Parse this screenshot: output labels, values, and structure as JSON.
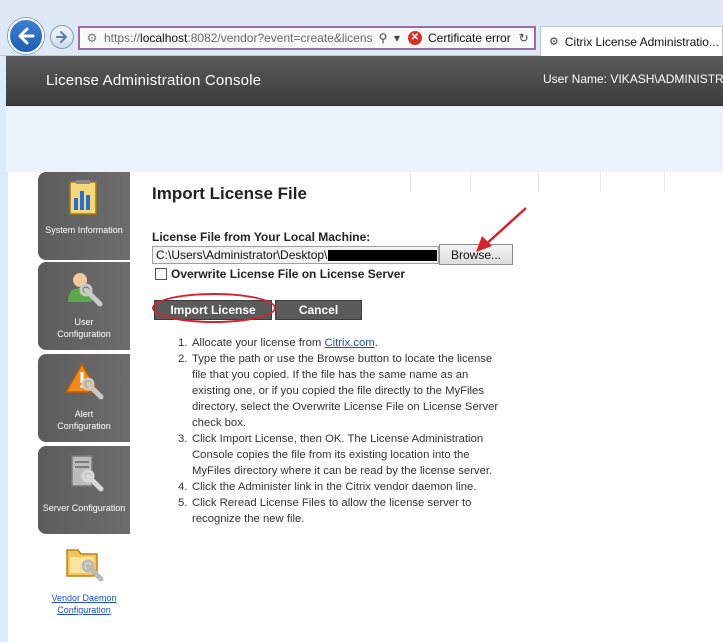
{
  "browser": {
    "url_prefix": "https://",
    "url_host": "localhost",
    "url_rest": ":8082/vendor?event=create&licens",
    "cert_error": "Certificate error",
    "tab_title": "Citrix License Administratio..."
  },
  "header": {
    "title": "License Administration Console",
    "user": "User Name: VIKASH\\ADMINISTRA"
  },
  "sidebar": {
    "items": [
      {
        "label_lines": [
          "System Information"
        ]
      },
      {
        "label_lines": [
          "User",
          "Configuration"
        ]
      },
      {
        "label_lines": [
          "Alert",
          "Configuration"
        ]
      },
      {
        "label_lines": [
          "Server Configuration"
        ]
      },
      {
        "label_lines": [
          "Vendor Daemon",
          "Configuration"
        ]
      }
    ]
  },
  "main": {
    "title": "Import License File",
    "file_label": "License File from Your Local Machine:",
    "file_path": "C:\\Users\\Administrator\\Desktop\\",
    "browse_label": "Browse...",
    "overwrite_label": "Overwrite License File on License Server",
    "overwrite_checked": false,
    "import_label": "Import License",
    "cancel_label": "Cancel",
    "step1_prefix": "Allocate your license from ",
    "step1_link": "Citrix.com",
    "step1_suffix": ".",
    "steps": [
      "Type the path or use the Browse button to locate the license file that you copied. If the file has the same name as an existing one, or if you copied the file directly to the MyFiles directory, select the Overwrite License File on License Server check box.",
      "Click Import License, then OK. The License Administration Console copies the file from its existing location into the MyFiles directory where it can be read by the license server.",
      "Click the Administer link in the Citrix vendor daemon line.",
      "Click Reread License Files to allow the license server to recognize the new file."
    ],
    "step_numbers": [
      "1.",
      "2.",
      "3.",
      "4.",
      "5."
    ]
  },
  "colors": {
    "header_bg": "#484848",
    "sidebar_bg": "#626262",
    "highlight_red": "#d4232f",
    "link_blue": "#1f4fbf"
  }
}
